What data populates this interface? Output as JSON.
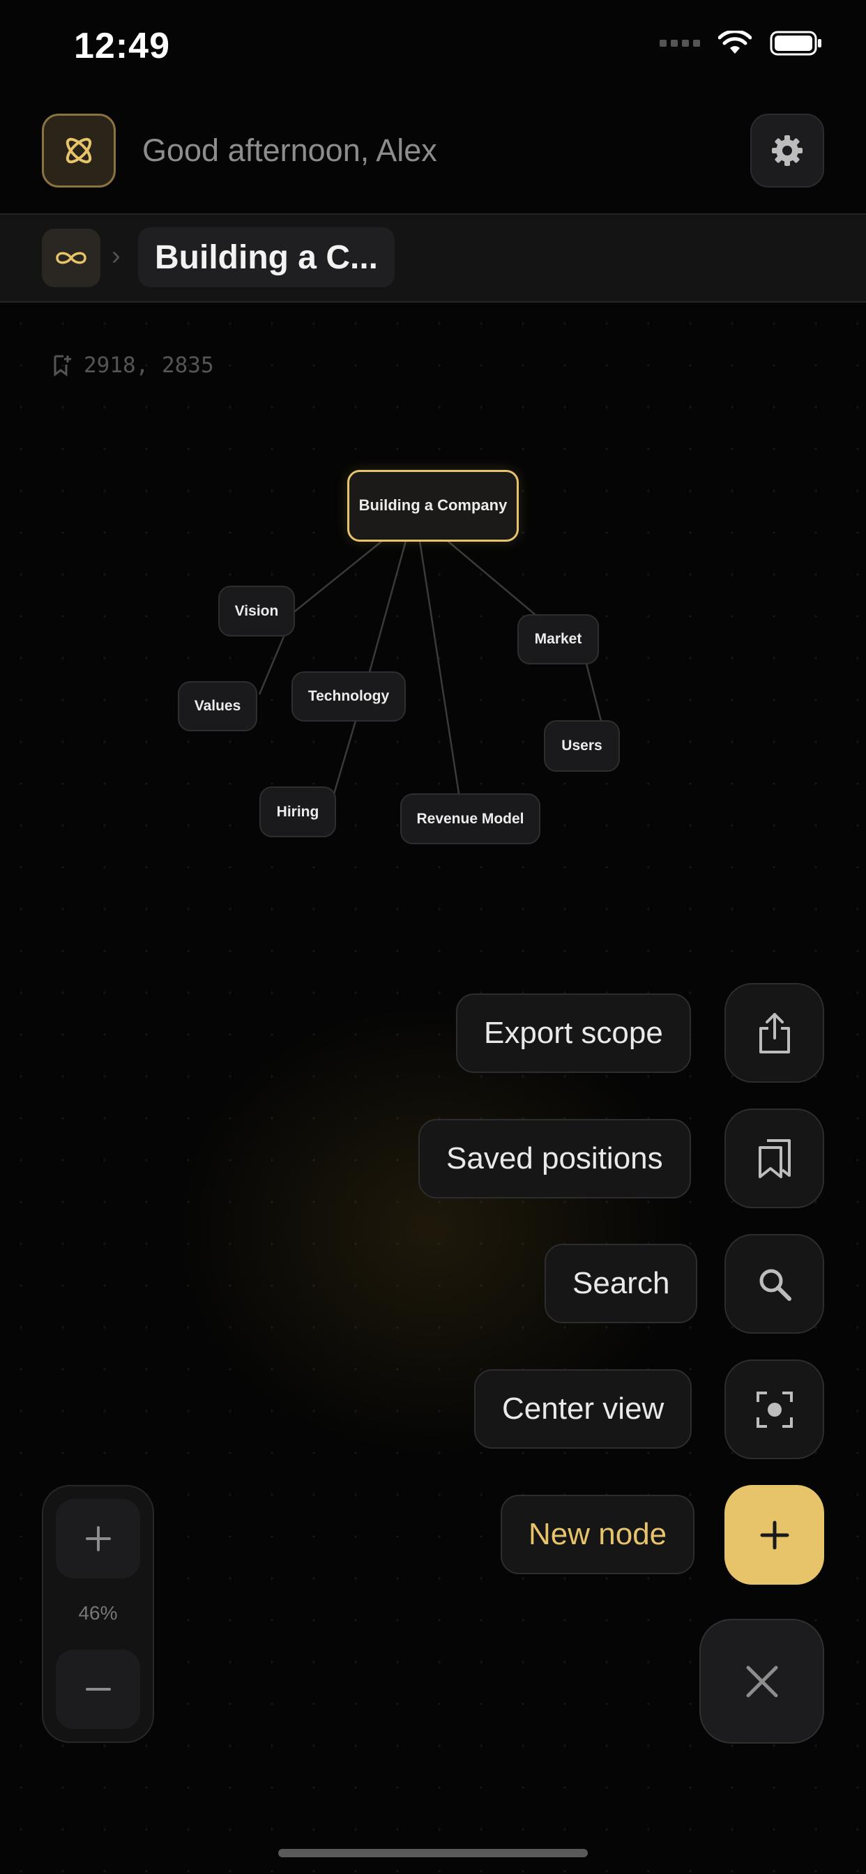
{
  "status_bar": {
    "time": "12:49"
  },
  "header": {
    "greeting": "Good afternoon, Alex"
  },
  "breadcrumb": {
    "separator": "›",
    "current": "Building a C..."
  },
  "canvas": {
    "coordinates": "2918, 2835"
  },
  "map": {
    "root": "Building a Company",
    "nodes": {
      "vision": "Vision",
      "values": "Values",
      "technology": "Technology",
      "hiring": "Hiring",
      "revenue_model": "Revenue Model",
      "market": "Market",
      "users": "Users"
    }
  },
  "fab_menu": {
    "export": "Export scope",
    "saved": "Saved positions",
    "search": "Search",
    "center": "Center view",
    "new_node": "New node"
  },
  "zoom": {
    "level": "46%"
  },
  "colors": {
    "accent": "#e7c46a",
    "background": "#050505",
    "surface": "#161617"
  },
  "icons": [
    "logo-icon",
    "gear-icon",
    "infinity-icon",
    "bookmark-add-icon",
    "share-icon",
    "bookmarks-icon",
    "search-icon",
    "focus-icon",
    "plus-icon",
    "close-icon",
    "minus-icon"
  ]
}
